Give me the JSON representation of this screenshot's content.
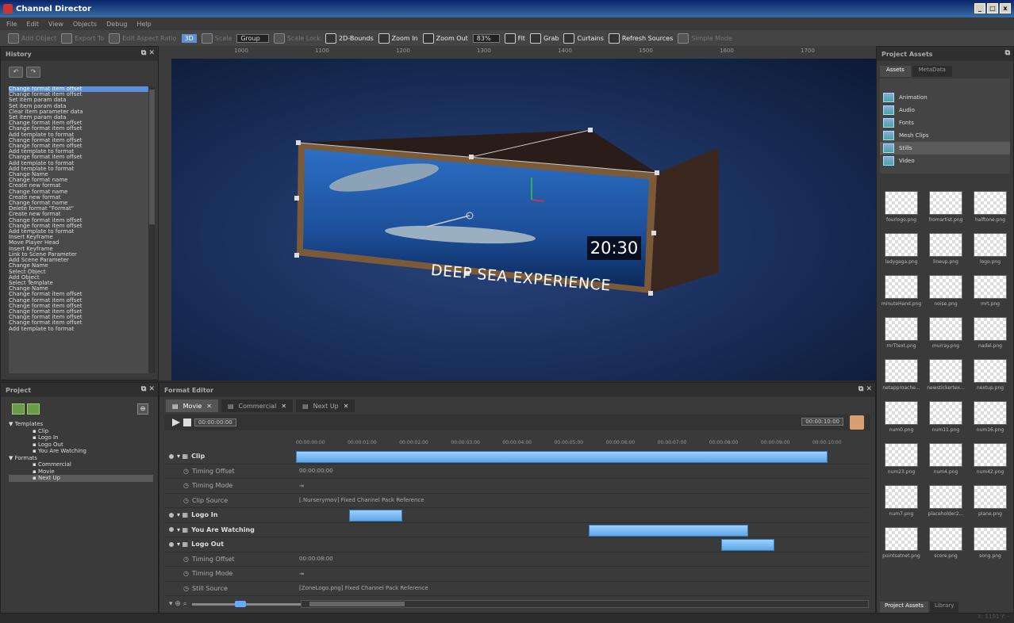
{
  "window": {
    "title": "Channel Director"
  },
  "menu": [
    "File",
    "Edit",
    "View",
    "Objects",
    "Debug",
    "Help"
  ],
  "toolbar": {
    "items": [
      {
        "label": "Add Object",
        "on": false
      },
      {
        "label": "Export To",
        "on": false
      },
      {
        "label": "Edit Aspect Ratio",
        "on": false
      },
      {
        "label": "3D",
        "on": true,
        "sel": true
      },
      {
        "label": "Scale",
        "on": false
      },
      {
        "label": "Group",
        "on": false,
        "dropdown": true
      },
      {
        "label": "Scale Lock",
        "on": false
      },
      {
        "label": "2D-Bounds",
        "on": true
      },
      {
        "label": "Zoom In",
        "on": true
      },
      {
        "label": "Zoom Out",
        "on": true
      },
      {
        "label": "83%",
        "on": true,
        "dropdown": true
      },
      {
        "label": "Fit",
        "on": true
      },
      {
        "label": "Grab",
        "on": true
      },
      {
        "label": "Curtains",
        "on": true
      },
      {
        "label": "Refresh Sources",
        "on": true
      },
      {
        "label": "Simple Mode",
        "on": false
      }
    ]
  },
  "history": {
    "title": "History",
    "items": [
      "Change format item offset",
      "Change format item offset",
      "Set item param data",
      "Set item param data",
      "Clear item parameter data",
      "Set item param data",
      "Change format item offset",
      "Change format item offset",
      "Add template to format",
      "Change format item offset",
      "Change format item offset",
      "Add template to format",
      "Change format item offset",
      "Add template to format",
      "Add template to format",
      "Change Name",
      "Change format name",
      "Create new format",
      "Change format name",
      "Create new format",
      "Change format name",
      "Delete format \"Format\"",
      "Create new format",
      "Change format item offset",
      "Change format item offset",
      "Add template to format",
      "Insert Keyframe",
      "Move Player Head",
      "Insert Keyframe",
      "Link to Scene Parameter",
      "Add Scene Parameter",
      "Change Name",
      "Select Object",
      "Add Object",
      "Select Template",
      "Change Name",
      "Change format item offset",
      "Change format item offset",
      "Change format item offset",
      "Change format item offset",
      "Change format item offset",
      "Change format item offset",
      "Add template to format"
    ]
  },
  "viewport": {
    "ruler_ticks": [
      "1000",
      "1100",
      "1200",
      "1300",
      "1400",
      "1500",
      "1600",
      "1700",
      "1800"
    ],
    "clock": "20:30",
    "caption": "DEEP SEA EXPERIENCE"
  },
  "assets": {
    "title": "Project Assets",
    "tabs": [
      "Assets",
      "MetaData"
    ],
    "categories": [
      "Animation",
      "Audio",
      "Fonts",
      "Mesh Clips",
      "Stills",
      "Video"
    ],
    "selected_category": 4,
    "thumbs": [
      "fourlogo.png",
      "fromartist.png",
      "halftone.png",
      "ladygaga.png",
      "lineup.png",
      "logo.png",
      "minuteHand.png",
      "noise.png",
      "mrt.png",
      "mrTtext.png",
      "murray.png",
      "nadal.png",
      "netapproache...",
      "newstickertex...",
      "nextup.png",
      "num0.png",
      "num11.png",
      "num16.png",
      "num23.png",
      "num4.png",
      "num42.png",
      "num7.png",
      "placeholder2...",
      "plane.png",
      "pointsatnet.png",
      "score.png",
      "song.png"
    ],
    "bottom_tabs": [
      "Project Assets",
      "Library"
    ]
  },
  "project": {
    "title": "Project",
    "tree": [
      {
        "label": "Templates",
        "level": 1
      },
      {
        "label": "Clip",
        "level": 2
      },
      {
        "label": "Logo In",
        "level": 2
      },
      {
        "label": "Logo Out",
        "level": 2
      },
      {
        "label": "You Are Watching",
        "level": 2
      },
      {
        "label": "Formats",
        "level": 1
      },
      {
        "label": "Commercial",
        "level": 2
      },
      {
        "label": "Movie",
        "level": 2
      },
      {
        "label": "Next Up",
        "level": 2,
        "sel": true
      }
    ]
  },
  "format": {
    "title": "Format Editor",
    "tabs": [
      {
        "label": "Movie",
        "act": true
      },
      {
        "label": "Commercial",
        "act": false
      },
      {
        "label": "Next Up",
        "act": false
      }
    ],
    "current_time": "00:00:00:00",
    "end_time": "00:00:10:00",
    "ruler": [
      "00:00:00:00",
      "00:00:01:00",
      "00:00:02:00",
      "00:00:03:00",
      "00:00:04:00",
      "00:00:05:00",
      "00:00:06:00",
      "00:00:07:00",
      "00:00:08:00",
      "00:00:09:00",
      "00:00:10:00"
    ],
    "duration": 10,
    "rows": [
      {
        "name": "Clip",
        "type": "track",
        "start": 0,
        "end": 10
      },
      {
        "name": "Timing Offset",
        "type": "param",
        "value": "00:00:00:00"
      },
      {
        "name": "Timing Mode",
        "type": "param",
        "value": "⇥"
      },
      {
        "name": "Clip Source",
        "type": "param",
        "value": "[.Nurserymov] Fixed Channel Pack Reference"
      },
      {
        "name": "Logo In",
        "type": "track",
        "start": 1,
        "end": 2
      },
      {
        "name": "You Are Watching",
        "type": "track",
        "start": 5.5,
        "end": 8.5
      },
      {
        "name": "Logo Out",
        "type": "track",
        "start": 8,
        "end": 9
      },
      {
        "name": "Timing Offset",
        "type": "param",
        "value": "00:00:08:00"
      },
      {
        "name": "Timing Mode",
        "type": "param",
        "value": "⇥"
      },
      {
        "name": "Still Source",
        "type": "param",
        "value": "[ZoneLogo.png] Fixed Channel Pack Reference"
      }
    ]
  },
  "status": {
    "coords": "X: 1191 Y: -"
  }
}
